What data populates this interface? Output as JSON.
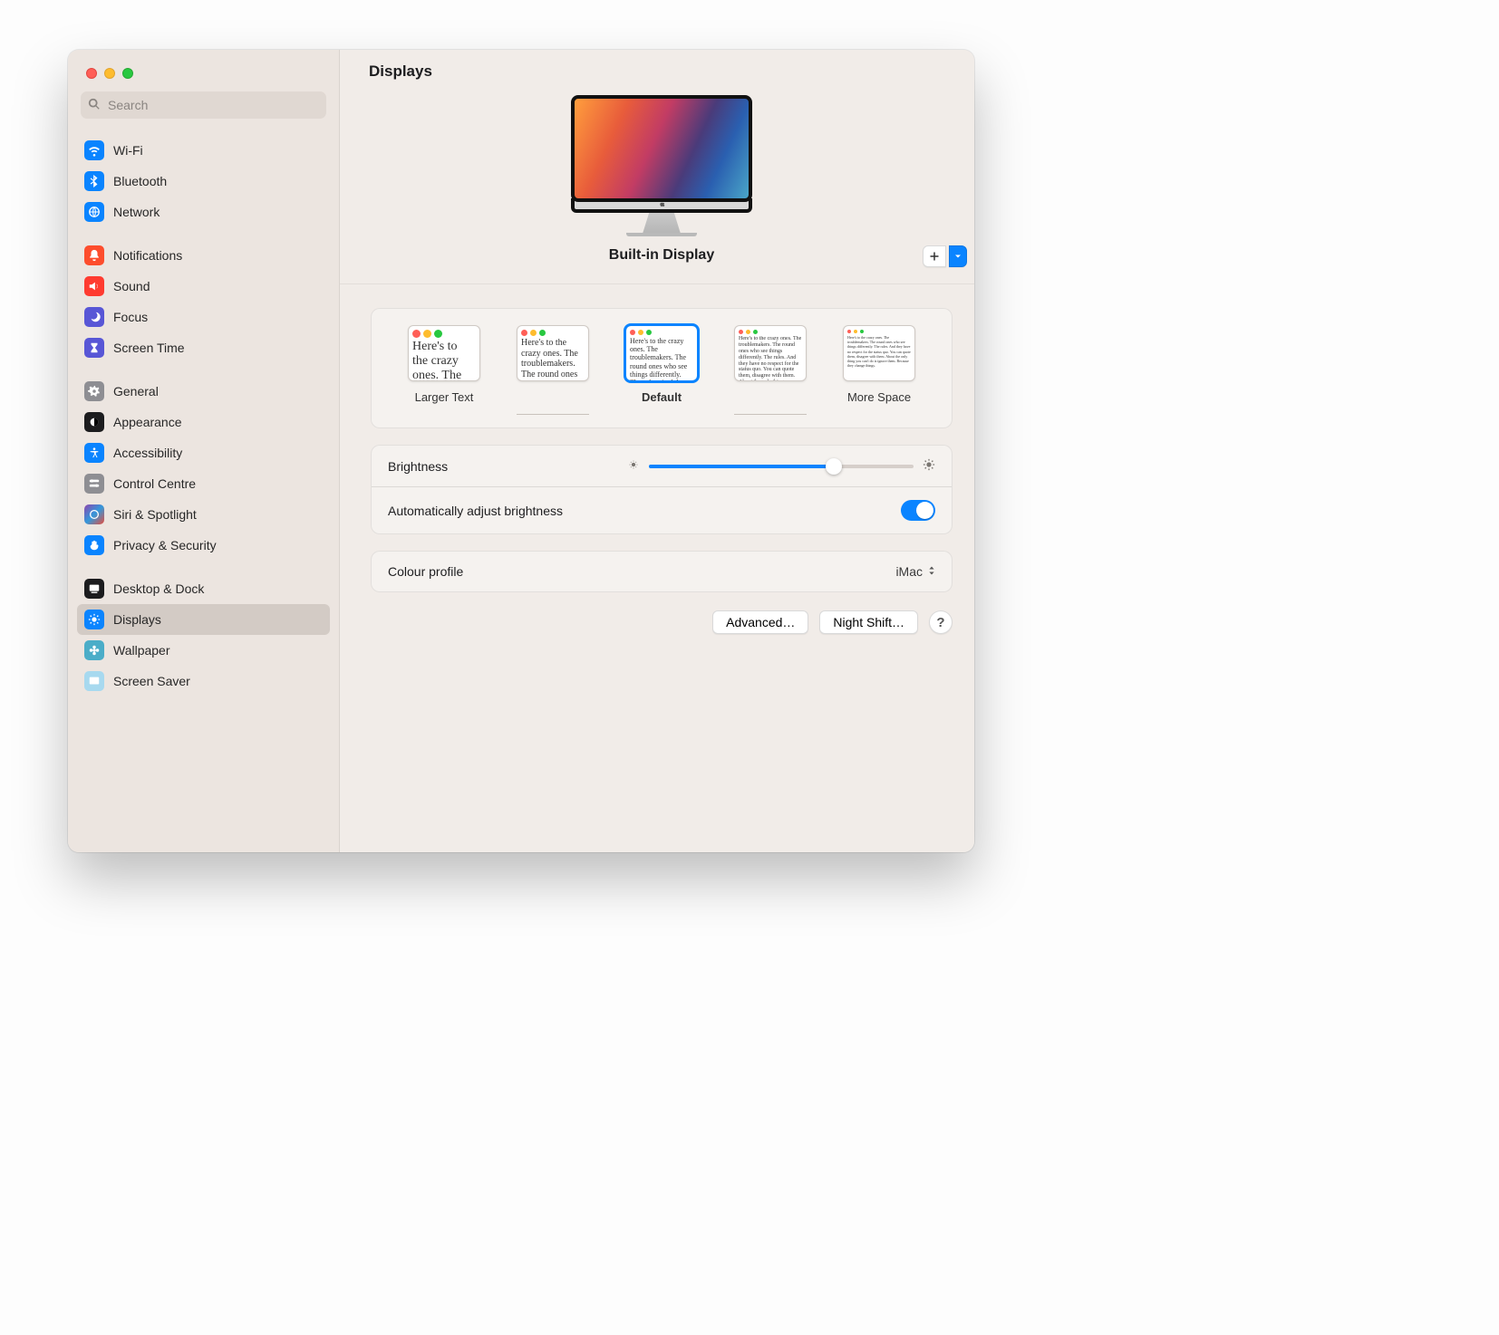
{
  "window": {
    "title": "Displays"
  },
  "search": {
    "placeholder": "Search"
  },
  "sidebar": {
    "groups": [
      [
        {
          "key": "wifi",
          "label": "Wi-Fi"
        },
        {
          "key": "bluetooth",
          "label": "Bluetooth"
        },
        {
          "key": "network",
          "label": "Network"
        }
      ],
      [
        {
          "key": "notifications",
          "label": "Notifications"
        },
        {
          "key": "sound",
          "label": "Sound"
        },
        {
          "key": "focus",
          "label": "Focus"
        },
        {
          "key": "screentime",
          "label": "Screen Time"
        }
      ],
      [
        {
          "key": "general",
          "label": "General"
        },
        {
          "key": "appearance",
          "label": "Appearance"
        },
        {
          "key": "accessibility",
          "label": "Accessibility"
        },
        {
          "key": "controlcentre",
          "label": "Control Centre"
        },
        {
          "key": "siri",
          "label": "Siri & Spotlight"
        },
        {
          "key": "privacy",
          "label": "Privacy & Security"
        }
      ],
      [
        {
          "key": "desktopdock",
          "label": "Desktop & Dock"
        },
        {
          "key": "displays",
          "label": "Displays"
        },
        {
          "key": "wallpaper",
          "label": "Wallpaper"
        },
        {
          "key": "screensaver",
          "label": "Screen Saver"
        }
      ]
    ]
  },
  "display": {
    "name": "Built-in Display"
  },
  "resolution": {
    "sample_text": "Here's to the crazy ones. The troublemakers. The round ones who see things differently. The rules. And they have no respect for the status quo. You can quote them, disagree with them. About the only thing you can't do is ignore them. Because they change things.",
    "options": [
      {
        "caption": "Larger Text",
        "size": 1,
        "selected": false
      },
      {
        "caption": "",
        "size": 2,
        "selected": false
      },
      {
        "caption": "Default",
        "size": 3,
        "selected": true
      },
      {
        "caption": "",
        "size": 4,
        "selected": false
      },
      {
        "caption": "More Space",
        "size": 5,
        "selected": false
      }
    ]
  },
  "brightness": {
    "label": "Brightness",
    "value_percent": 70
  },
  "auto_brightness": {
    "label": "Automatically adjust brightness",
    "on": true
  },
  "color_profile": {
    "label": "Colour profile",
    "value": "iMac"
  },
  "buttons": {
    "advanced": "Advanced…",
    "night_shift": "Night Shift…",
    "help": "?"
  }
}
